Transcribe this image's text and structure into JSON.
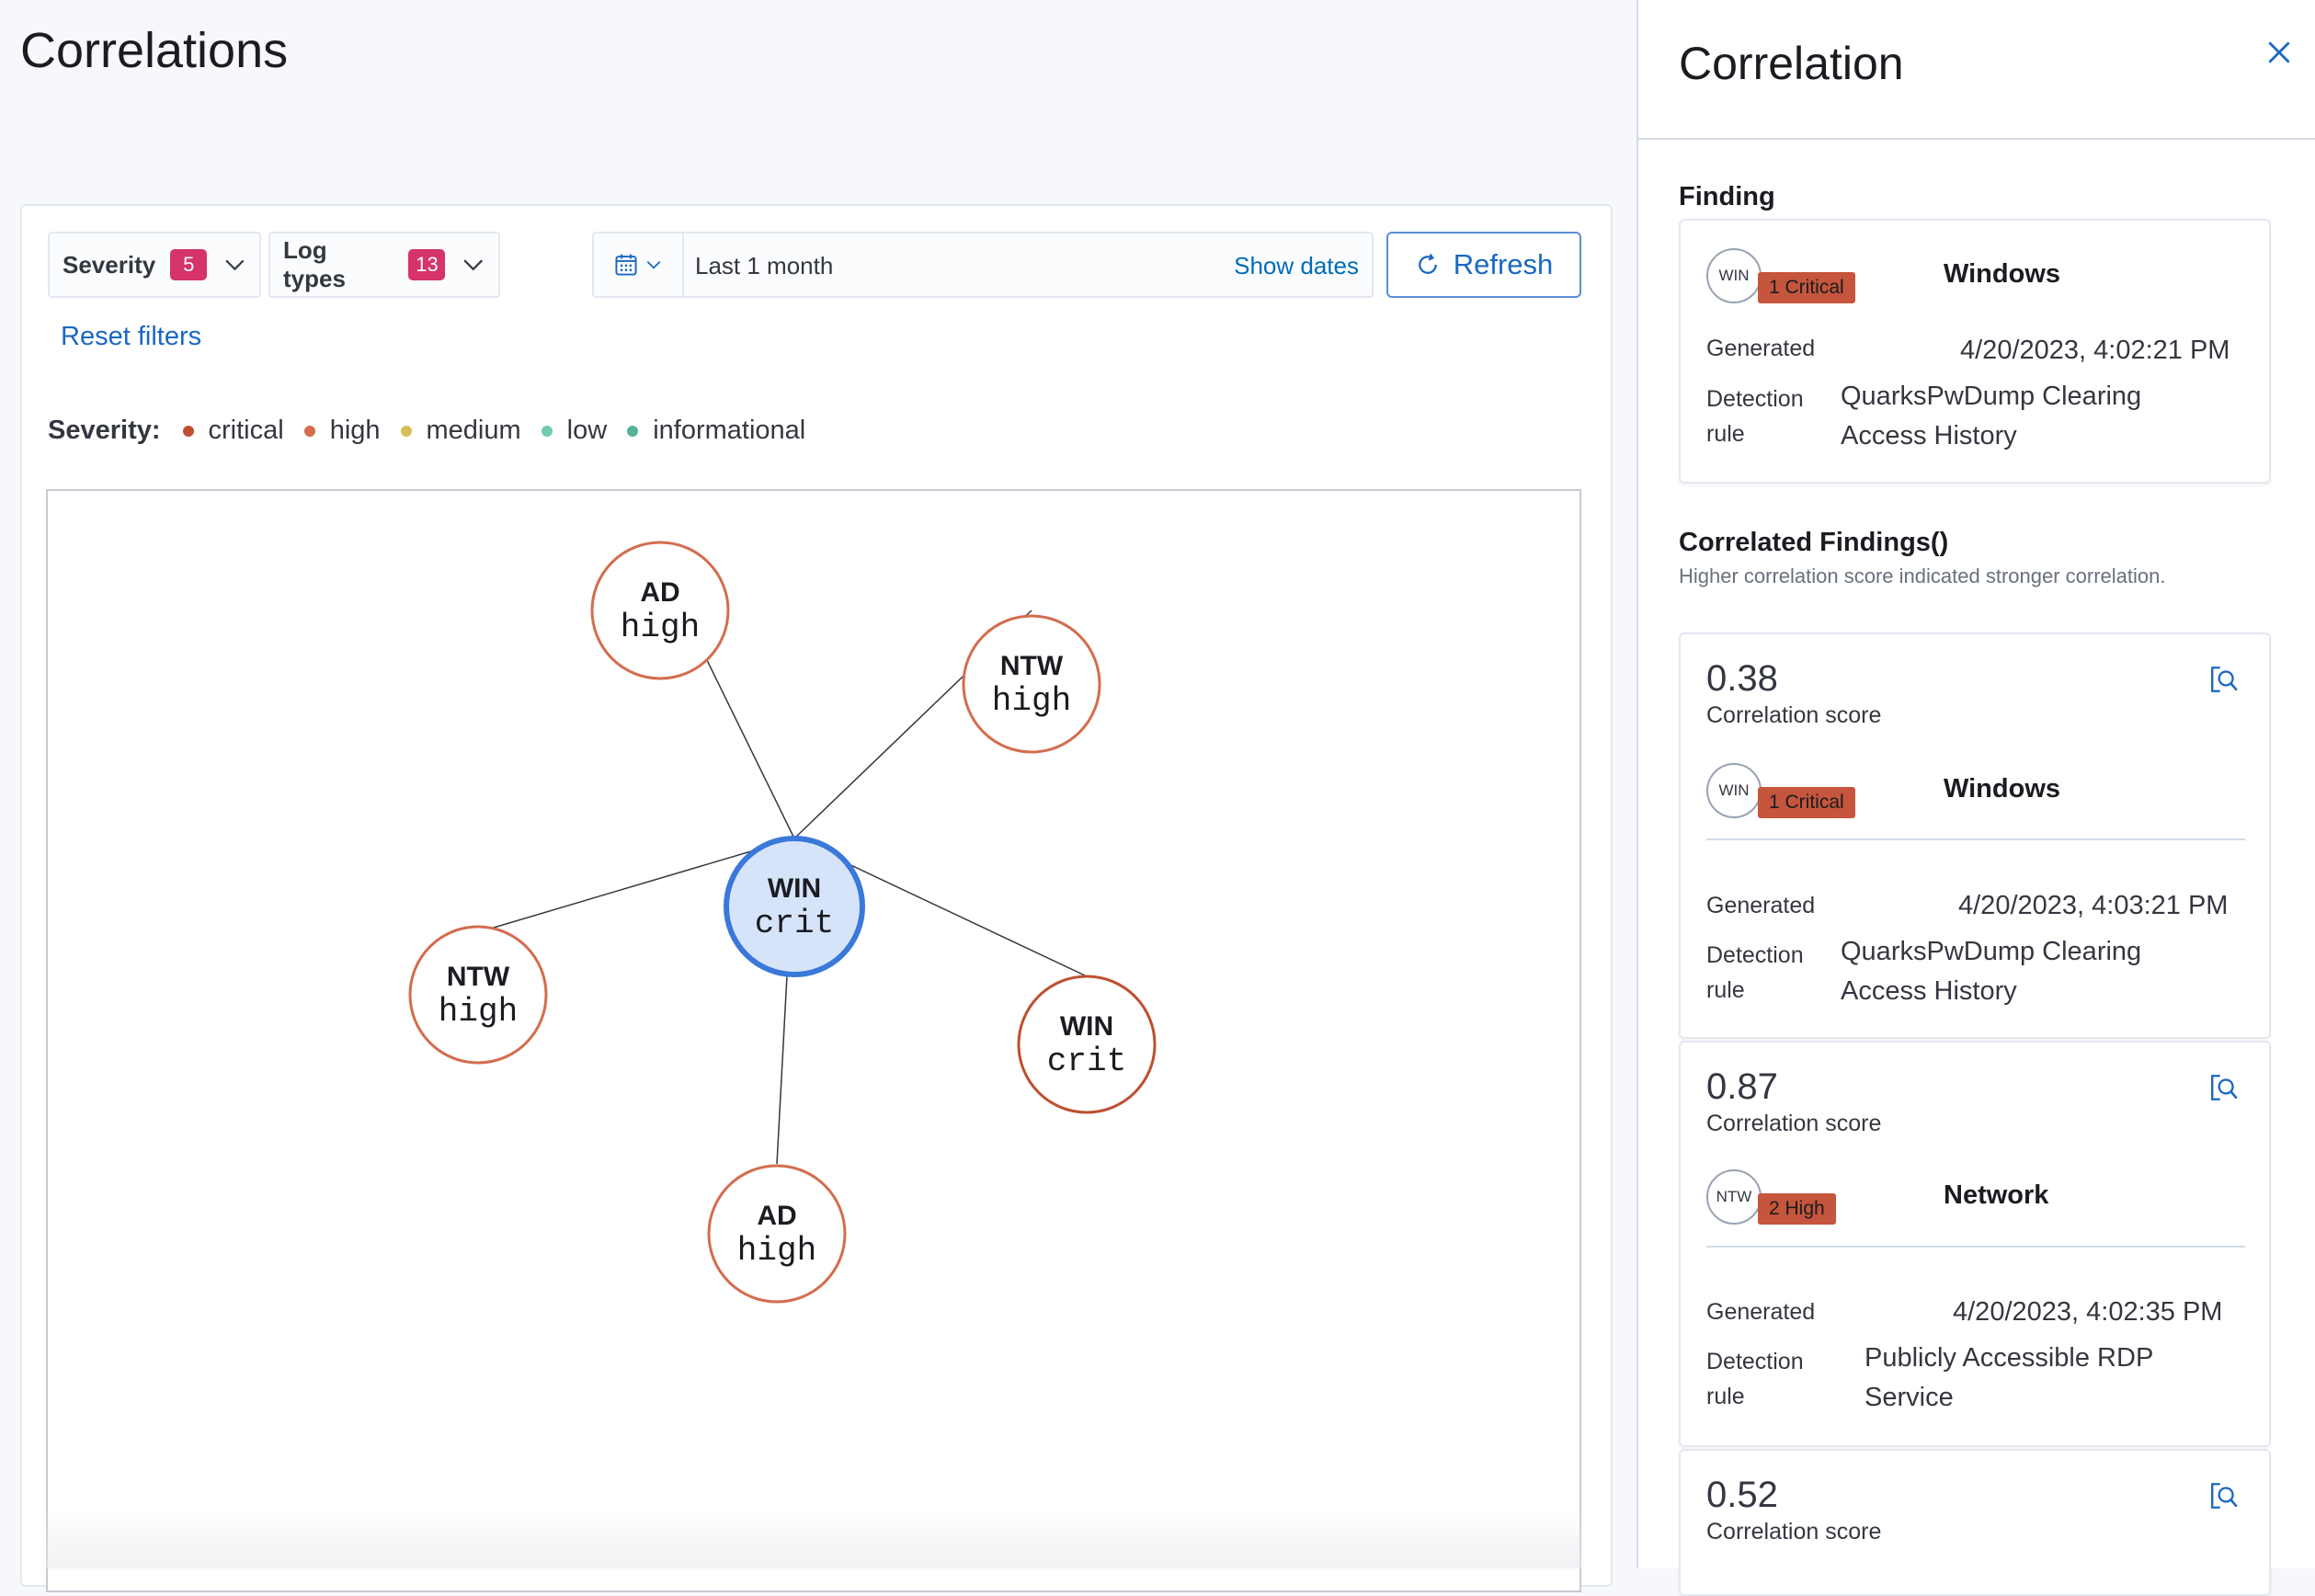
{
  "page_title": "Correlations",
  "filters": {
    "severity": {
      "label": "Severity",
      "count": "5"
    },
    "log_types": {
      "label": "Log types",
      "count": "13"
    }
  },
  "date_picker": {
    "value": "Last 1 month",
    "show_dates": "Show dates",
    "icon": "calendar-icon"
  },
  "refresh_label": "Refresh",
  "reset_filters": "Reset filters",
  "legend": {
    "title": "Severity:",
    "items": [
      {
        "label": "critical",
        "color": "#bd4f30"
      },
      {
        "label": "high",
        "color": "#d36d4e"
      },
      {
        "label": "medium",
        "color": "#d6bf57"
      },
      {
        "label": "low",
        "color": "#6dccb1"
      },
      {
        "label": "informational",
        "color": "#54b399"
      }
    ]
  },
  "graph": {
    "center": {
      "type": "WIN",
      "severity": "crit"
    },
    "nodes": [
      {
        "type": "AD",
        "severity": "high"
      },
      {
        "type": "NTW",
        "severity": "high"
      },
      {
        "type": "NTW",
        "severity": "high"
      },
      {
        "type": "WIN",
        "severity": "crit"
      },
      {
        "type": "AD",
        "severity": "high"
      }
    ]
  },
  "flyout": {
    "title": "Correlation",
    "finding": {
      "section_title": "Finding",
      "log_short": "WIN",
      "severity_badge": "1 Critical",
      "log_name": "Windows",
      "generated_label": "Generated",
      "generated_value": "4/20/2023, 4:02:21 PM",
      "rule_label_1": "Detection",
      "rule_label_2": "rule",
      "rule_line_1": "QuarksPwDump Clearing",
      "rule_line_2": "Access History"
    },
    "correlated": {
      "section_title": "Correlated Findings()",
      "subtitle": "Higher correlation score indicated stronger correlation.",
      "score_label": "Correlation score",
      "generated_label": "Generated",
      "rule_label_1": "Detection",
      "rule_label_2": "rule",
      "items": [
        {
          "score": "0.38",
          "log_short": "WIN",
          "severity_badge": "1 Critical",
          "log_name": "Windows",
          "generated_value": "4/20/2023, 4:03:21 PM",
          "rule_line_1": "QuarksPwDump Clearing",
          "rule_line_2": "Access History"
        },
        {
          "score": "0.87",
          "log_short": "NTW",
          "severity_badge": "2 High",
          "log_name": "Network",
          "generated_value": "4/20/2023, 4:02:35 PM",
          "rule_line_1": "Publicly Accessible RDP",
          "rule_line_2": "Service"
        },
        {
          "score": "0.52"
        }
      ]
    }
  }
}
